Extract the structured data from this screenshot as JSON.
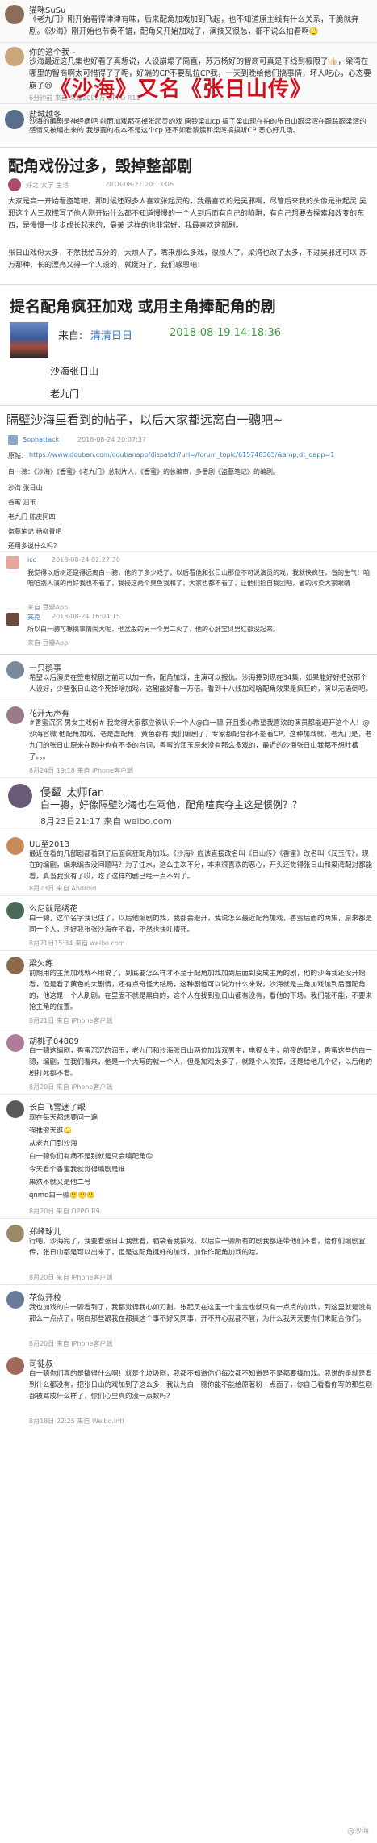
{
  "section1": {
    "comments": [
      {
        "user": "猫咪SuSu",
        "text": "《老九门》刚开始看得津津有味，后来配角加戏加到飞起，也不知道原主线有什么关系，干脆就弃剧。《沙海》刚开始也节奏不错，配角又开始加戏了，演技又很怂，都不说么拍看啊🙄",
        "meta": "",
        "likes": ""
      },
      {
        "user": "你的这个我~",
        "text": "沙海最近这几集也好看了真想说，人设崩塌了简直，苏万杨好的智商可真是下线到极限了👍🏻，梁湾在哪里的智商啊太可惜得了了呢，好端的CP不要乱拉CP我，一天到晚给他们搞事情，坏人吃心，心态要崩了😢",
        "meta": "6分钟前 来自 荣耀2000万 OPPO R11",
        "likes": ""
      },
      {
        "user": "盐城越冬",
        "text": "沙海的编剧是神经病吧 前面加戏都花掉张起灵的戏 唐铃梁山cp 搞了梁山现在拍的张日山跟梁湾在跟踪跟梁湾的感情又被编出来的 我想要的根本不是这个cp 还不如看黎簇和梁湾搞搞听CP 恶心好几场。",
        "meta": "40分钟前 来自 OPPO R9s",
        "likes": ""
      }
    ],
    "overlay": "《沙海》又名《张日山传》"
  },
  "section2": {
    "title": "配角戏份过多，毁掉整部剧",
    "author": "好之 大学 生活",
    "date": "2018-08-21 20:13:06",
    "para1": "大家是高一开始看盗笔吧，那时候还跟多人喜欢张起灵的，我最喜欢的是吴邪啊，尽管后来我的头像是张起灵 吴邪这个人三叔撑写了他人刚开始什么都不知道慢慢的一个人到后面有自己的陷阱，有自己想要去探索和改变的东西，是慢慢一步步成长起来的，最美 这样的也非常好，我最喜欢这部剧。",
    "para2": "张日山戏份太多，不然我给五分的，太烦人了，嘴来那么多戏，很烦人了。梁湾也改了太多，不过吴邪还可以 苏万那种，长的漂亮又得一个人设的，就挺好了，我们感恩吧！"
  },
  "section3": {
    "headline": "提名配角疯狂加戏 或用主角捧配角的剧",
    "source_label": "来自:",
    "source_name": "清清日日",
    "datetime": "2018-08-19 14:18:36",
    "line1": "沙海张日山",
    "line2": "老九门"
  },
  "section4": {
    "headline": "隔壁沙海里看到的帖子，以后大家都远离白一骢吧~",
    "author": "Sophattack",
    "date": "2018-08-24 20:07:37",
    "link_prefix": "原帖：",
    "link": "https://www.douban.com/doubanapp/dispatch?uri=/forum_topic/615748365/&amp;dt_dapp=1",
    "intro": "白一骢：《沙海》《香蜜》《老九门》总制片人，《香蜜》的总编审，多番剧《盗墓笔记》的编剧。",
    "items": [
      "沙海 张日山",
      "香蜜 润玉",
      "老九门 陈皮阿四",
      "盗墓笔记 杨柳青吧"
    ],
    "question": "还用多说什么吗？",
    "reply1": {
      "user": "icc",
      "date": "2018-08-24 02:27:30",
      "text": "我觉得以后树还是得远离白一骢，他的了多少戏了，以后看他和张日山那位不可说演员的戏，我就快疯狂，省的生气！咱咱咱别人演的再好我也不看了，我接这两个臭鱼我和了，大家也都不看了，让他们捡自我团吧，省的污染大家眼睛"
    },
    "reply_footer1": "来自 豆瓣App",
    "reply2": {
      "user": "夹克",
      "date": "2018-08-24 16:04:15",
      "text": "所以白一骢可想搞事情闹大呢，他盆般的另一个男二火了，他的心肝宝贝男红都没起来。"
    },
    "reply_footer2": "来自 豆瓣App"
  },
  "section5": {
    "comments": [
      {
        "user": "一只鹅事",
        "text": "希望以后演员在签电视剧之前可以加一条，配角加戏，主演可以报仇。沙海捧到现在34集，如果能好好把张那个人设好，少些张日山这个死掉啥加戏，这剧能好看一万倍。看到十八线加戏啥配角效果是疯狂的，演以无语倒吧。"
      },
      {
        "user": "花开无声有",
        "text": "#香蜜沉沉 男女主戏份# 我觉得大家都应该认识一个人@白一骢 开且委心希望我喜欢的演员都能避开这个人！@沙海官微 他配角加戏，老是虐配角，黄色都有 我们编剧了，专家都配合都不能着CP，这种加戏就，老九门是，老九门的张日山原来在剧中也有不多的台词，香蜜的润玉原来没有那么多戏的，最近的沙海张日山我都不想吐槽了。。。",
        "meta": "8月24日 19:18 来自 iPhone客户端"
      },
      {
        "user": "侵颦_太师fan",
        "text": "白一骢，好像隔壁沙海也在骂他，配角喧宾夺主这是惯例？？",
        "meta": "8月23日21:17 来自 weibo.com"
      },
      {
        "user": "UU至2013",
        "text": "最近在看的几部剧都看到了后面疯狂配角加戏。《沙海》应该直接改名叫《日山传》《香蜜》改名叫《润玉传》，现在的编剧，编来编去没问题吗？为了注水，这么主次不分，本来很喜欢的恶心，开头还觉得张日山和梁湾配对都能看，真当我没有了哎，吃了这样的剧已经一点不到了。",
        "meta": "8月23日 来自 Android"
      },
      {
        "user": "么尼就是绣花",
        "text": "白一骢，这个名字我记住了，以后他编剧的戏，我都会避开，我说怎么最近配角加戏，香蜜后面的两集，原来都是同一个人，还好我张张沙海在不看，不然也快吐槽死。",
        "meta": "8月21日15:34 来自 weibo.com"
      },
      {
        "user": "梁欠练",
        "text": "前期用的主角加戏就不用说了，到底要怎么样才不至于配角加戏加到后面到变成主角的剧，他的沙海我还没开始看，但是看了黄色的大剧情，还有点奇怪大结局，这种剧他可以说为什么来说，沙海就是主角加戏加到后面配角的，他这是一个人刷剧，在里面不就是黑白的，这个人在找到张日山都有没有，看他的下场，我们能不能，不要来抢主角的位置。",
        "meta": "8月21日 来自 iPhone客户端"
      },
      {
        "user": "胡桃子04809",
        "text": "白一骢这编剧，香蜜沉沉的润玉，老九门和沙海张日山两位加戏双男主，电视女主，前夜的配角，香蜜这些的白一骢，编剧，在我们看来，他是一个大写的就一个人，但是加戏太多了，就是个人吹捧，还是给他几个亿，以后他的剧打死都不看。",
        "meta": "8月20日 来自 iPhone客户端"
      },
      {
        "user": "长白飞雪迷了眼",
        "text": "现在每天都想要问一遍\n强推盗天逛🙄\n从老九门到沙海\n白一骢你们有病不是别就是只会编配角🙃\n今天看个香蜜我就觉得编剧是谁\n果然不就又是他二号\nqnmd白一骢🙂🙂🙂",
        "meta": "8月20日 来自 OPPO R9"
      },
      {
        "user": "郑峰球儿",
        "text": "行吧，沙海完了，我要看张日山我就看，脑袋着我搞戏，以后白一骢所有的剧我都连带他们不看，给你们编剧宣传，张日山都是可以出来了，但是这配角挺好的加戏，加作作配角加戏的哈。",
        "meta": "8月20日 来自 iPhone客户端"
      },
      {
        "user": "花似开校",
        "text": "我也加戏的白一骢看到了，我都觉得我心如刀割。张起灵在这里一个宝宝也就只有一点点的加戏，到这里就是没有那么一点点了，明白那些跟我在都搞这个事不好又同事，开不开心我都不管，为什么我天天要你们来配合你们。",
        "meta": "8月20日 来自 iPhone客户端"
      },
      {
        "user": "司徒叔",
        "text": "白一骢你们真的是搞得什么啊！就是个垃圾剧，我都不知道你们每次都不知道是不是都要搞加戏。我说的是就是看到什么都没有，把张日山的戏加到了这么多，我认为白一骢你能不能给原著粉一点面子，你自己看看你写的那些剧都被骂成什么样了，你们心里真的没一点数吗？",
        "meta": "8月18日 22:25 来自 Weibo.intl"
      }
    ]
  },
  "watermark": "@沙海"
}
